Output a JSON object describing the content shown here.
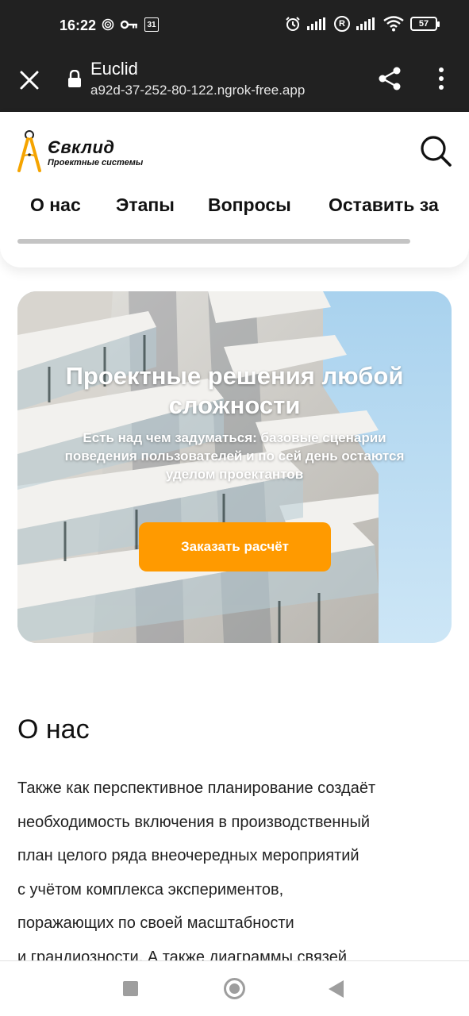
{
  "status_bar": {
    "time": "16:22",
    "left_icons": [
      "sync-icon",
      "key-icon",
      "calendar-icon"
    ],
    "calendar_day": "31",
    "right_icons": [
      "alarm-icon",
      "signal-icon",
      "roaming-icon",
      "signal-icon",
      "wifi-icon",
      "battery-icon"
    ],
    "roaming_letter": "R",
    "battery": "57"
  },
  "browser": {
    "title": "Euclid",
    "url": "a92d-37-252-80-122.ngrok-free.app"
  },
  "header": {
    "logo_name": "Євклид",
    "logo_sub": "Проектные системы",
    "accent_color": "#f5a400",
    "nav": [
      "О нас",
      "Этапы",
      "Вопросы",
      "Оставить за"
    ]
  },
  "hero": {
    "title_line1": "Проектные решения любой",
    "title_line2": "сложности",
    "subtitle_line1": "Есть над чем задуматься: базовые сценарии",
    "subtitle_line2": "поведения пользователей и по сей день остаются",
    "subtitle_line3": "уделом проектантов",
    "button": "Заказать расчёт",
    "button_color": "#ff9a00"
  },
  "about": {
    "title": "О нас",
    "lines": [
      "Также как перспективное планирование создаёт",
      "необходимость включения в производственный",
      "план целого ряда внеочередных мероприятий",
      "с учётом комплекса экспериментов,",
      "поражающих по своей масштабности",
      "и грандиозности. А также диаграммы связей"
    ]
  },
  "system_nav": [
    "recents-button",
    "home-button",
    "back-button"
  ]
}
